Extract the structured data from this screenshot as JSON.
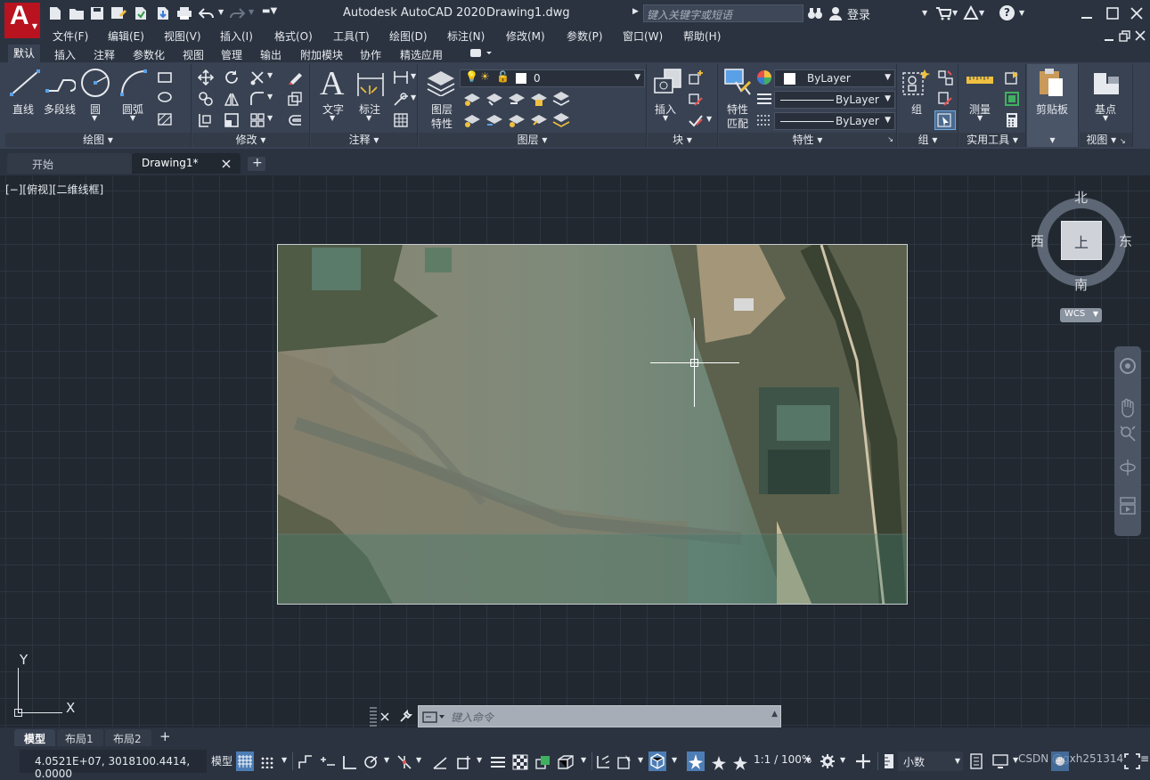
{
  "app": {
    "title": "Autodesk AutoCAD 2020",
    "file": "Drawing1.dwg",
    "search_placeholder": "键入关键字或短语",
    "login": "登录",
    "logo_letter": "A"
  },
  "menu": [
    "文件(F)",
    "编辑(E)",
    "视图(V)",
    "插入(I)",
    "格式(O)",
    "工具(T)",
    "绘图(D)",
    "标注(N)",
    "修改(M)",
    "参数(P)",
    "窗口(W)",
    "帮助(H)"
  ],
  "ribbon_tabs": [
    "默认",
    "插入",
    "注释",
    "参数化",
    "视图",
    "管理",
    "输出",
    "附加模块",
    "协作",
    "精选应用"
  ],
  "ribbon": {
    "draw": {
      "title": "绘图",
      "line": "直线",
      "polyline": "多段线",
      "circle": "圆",
      "arc": "圆弧"
    },
    "modify": {
      "title": "修改"
    },
    "annotation": {
      "title": "注释",
      "text": "文字",
      "dimension": "标注"
    },
    "layers": {
      "title": "图层",
      "props_a": "图层",
      "props_b": "特性",
      "current": "0"
    },
    "block": {
      "title": "块",
      "insert": "插入"
    },
    "properties": {
      "title": "特性",
      "match_a": "特性",
      "match_b": "匹配",
      "color": "ByLayer",
      "linetype": "ByLayer",
      "lineweight": "ByLayer"
    },
    "groups": {
      "title": "组",
      "group": "组"
    },
    "utilities": {
      "title": "实用工具",
      "measure": "测量"
    },
    "clipboard": {
      "title": "剪贴板"
    },
    "view": {
      "title": "视图",
      "base": "基点"
    }
  },
  "doc_tabs": {
    "start": "开始",
    "drawing": "Drawing1*"
  },
  "viewport_label": "[−][俯视][二维线框]",
  "viewcube": {
    "north": "北",
    "south": "南",
    "east": "东",
    "west": "西",
    "top": "上",
    "wcs": "WCS"
  },
  "ucs": {
    "x": "X",
    "y": "Y"
  },
  "command": {
    "placeholder": "键入命令"
  },
  "layout_tabs": [
    "模型",
    "布局1",
    "布局2"
  ],
  "status": {
    "coords": "4.0521E+07, 3018100.4414, 0.0000",
    "model": "模型",
    "scale": "1:1 / 100%",
    "units": "小数",
    "watermark": "CSDN @gxh251314"
  }
}
